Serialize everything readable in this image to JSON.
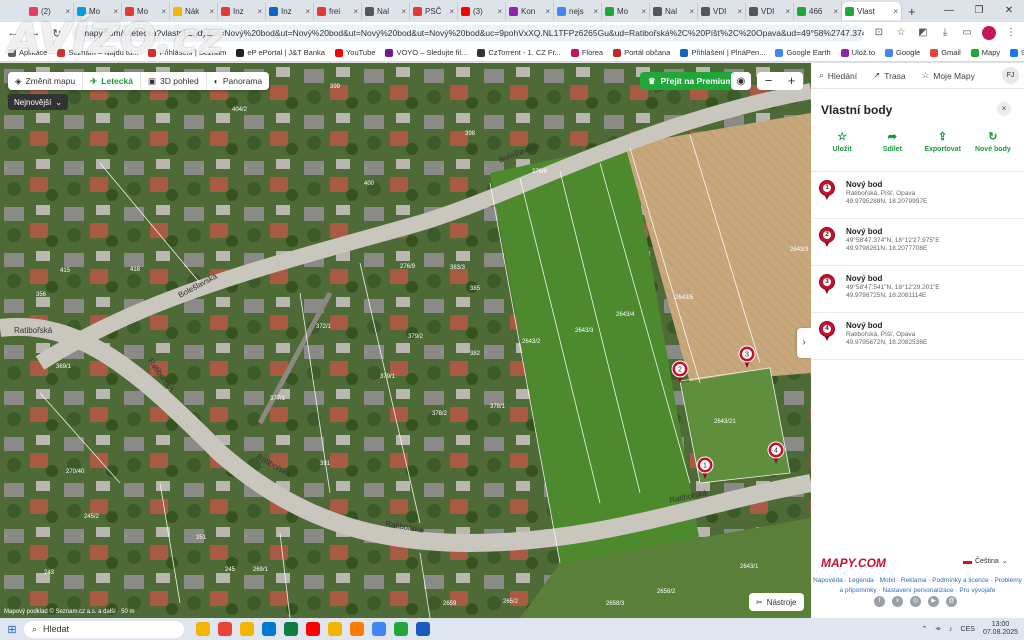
{
  "browser": {
    "tabs": [
      {
        "label": "(2)",
        "color": "#e4405f"
      },
      {
        "label": "Mo",
        "color": "#00a0e0"
      },
      {
        "label": "Mo",
        "color": "#e53935"
      },
      {
        "label": "Nák",
        "color": "#f4b400"
      },
      {
        "label": "Inz",
        "color": "#e53935"
      },
      {
        "label": "Inz",
        "color": "#0a66c2"
      },
      {
        "label": "frei",
        "color": "#e53935"
      },
      {
        "label": "Nal",
        "color": "#555"
      },
      {
        "label": "PSČ",
        "color": "#e53935"
      },
      {
        "label": "(3)",
        "color": "#ff0000"
      },
      {
        "label": "Kon",
        "color": "#8e24aa"
      },
      {
        "label": "nejs",
        "color": "#4285f4"
      },
      {
        "label": "Mo",
        "color": "#1fa839"
      },
      {
        "label": "Nal",
        "color": "#555"
      },
      {
        "label": "VDI",
        "color": "#555"
      },
      {
        "label": "VDI",
        "color": "#555"
      },
      {
        "label": "466",
        "color": "#1fa839"
      },
      {
        "label": "Vlast",
        "color": "#1fa839",
        "active": true
      }
    ],
    "url": "mapy.com/s/letecka?vlastni-body&ut=Nový%20bod&ut=Nový%20bod&ut=Nový%20bod&ut=Nový%20bod&uc=9pohVxXQ.NL1TFPz6265Gu&ud=Ratibořská%2C%20Píšť%2C%20Opava&ud=49°58%2747.374\"N%2C%2018°...",
    "bookmarks": [
      {
        "label": "Aplikace",
        "color": "#5f6368"
      },
      {
        "label": "Seznam – Najdu tu...",
        "color": "#d32f2f"
      },
      {
        "label": "Přihlášení | Seznam",
        "color": "#d32f2f"
      },
      {
        "label": "eP ePortal | J&T Banka",
        "color": "#222"
      },
      {
        "label": "YouTube",
        "color": "#ff0000"
      },
      {
        "label": "VOYO – Sledujte fil...",
        "color": "#6a1b9a"
      },
      {
        "label": "CzTorrent - 1. CZ Fr...",
        "color": "#333"
      },
      {
        "label": "Florea",
        "color": "#c2185b"
      },
      {
        "label": "Portál občana",
        "color": "#c62828"
      },
      {
        "label": "Přihlášení | PlnáPen...",
        "color": "#1565c0"
      },
      {
        "label": "Google Earth",
        "color": "#4285f4"
      },
      {
        "label": "Ulož.to",
        "color": "#8e24aa"
      },
      {
        "label": "Google",
        "color": "#4285f4"
      },
      {
        "label": "Gmail",
        "color": "#ea4335"
      },
      {
        "label": "Mapy",
        "color": "#1fa839"
      },
      {
        "label": "9",
        "color": "#1877f2"
      }
    ]
  },
  "watermark": "AVÍZO.cz",
  "map": {
    "toolbar": [
      {
        "label": "Změnit mapu",
        "icon": "layers-icon"
      },
      {
        "label": "Letecká",
        "icon": "plane-icon",
        "active": true
      },
      {
        "label": "3D pohled",
        "icon": "cube-icon"
      },
      {
        "label": "Panorama",
        "icon": "panorama-icon"
      }
    ],
    "newest_select": "Nejnovější",
    "premium_label": "Přejít na Premium",
    "zoom_out": "−",
    "zoom_in": "+",
    "tools_label": "Nástroje",
    "streets": [
      "Bolešlavská",
      "Bolešlavská",
      "Ratibořská",
      "Ratibořská",
      "Ratibořská",
      "Ratibořská",
      "Ratibořská",
      "Bolešlavská"
    ],
    "parcels": [
      "399",
      "404/2",
      "400",
      "398",
      "415",
      "418",
      "356",
      "372/1",
      "379/2",
      "382",
      "379/1",
      "377/1",
      "2643/5",
      "2643/3",
      "2643/4",
      "2643/2",
      "2643/21",
      "2643/3",
      "276/6",
      "276/9",
      "383/3",
      "385",
      "378/2",
      "378/1",
      "270/40",
      "245/2",
      "351",
      "245",
      "243",
      "2659",
      "2658/3",
      "2658/2",
      "2643/1",
      "265/2",
      "269/1",
      "369/1",
      "391"
    ],
    "markers": [
      "1",
      "2",
      "3",
      "4"
    ],
    "scale": "Mapový podklad © Seznam.cz a.s. a další · 50 m"
  },
  "sidebar": {
    "nav": [
      {
        "label": "Hledání",
        "icon": "search-icon"
      },
      {
        "label": "Trasa",
        "icon": "route-icon"
      },
      {
        "label": "Moje Mapy",
        "icon": "star-icon"
      }
    ],
    "avatar": "FJ",
    "title": "Vlastní body",
    "close": "×",
    "actions": [
      {
        "label": "Uložit",
        "icon": "star-icon"
      },
      {
        "label": "Sdílet",
        "icon": "share-icon"
      },
      {
        "label": "Exportovat",
        "icon": "export-icon"
      },
      {
        "label": "Nové body",
        "icon": "refresh-icon"
      }
    ],
    "points": [
      {
        "num": "1",
        "title": "Nový bod",
        "line1": "Ratibořská, Píšť, Opava",
        "line2": "49.9795288N, 18.2079997E"
      },
      {
        "num": "2",
        "title": "Nový bod",
        "line1": "49°58'47.374\"N, 18°12'27.975\"E",
        "line2": "49.9798261N, 18.2077708E"
      },
      {
        "num": "3",
        "title": "Nový bod",
        "line1": "49°58'47.541\"N, 18°12'29.201\"E",
        "line2": "49.9798725N, 18.2081114E"
      },
      {
        "num": "4",
        "title": "Nový bod",
        "line1": "Ratibořská, Píšť, Opava",
        "line2": "49.9795672N, 18.2082536E"
      }
    ],
    "logo": "MAPY.COM",
    "language": "Čeština",
    "links": "Nápověda · Legenda · Mobil · Reklama · Podmínky a licence · Problémy a připomínky · Nastavení personalizace · Pro vývojáře"
  },
  "taskbar": {
    "search": "Hledat",
    "apps": [
      "#f4b400",
      "#ea4335",
      "#f4b400",
      "#0078d4",
      "#107c41",
      "#ff0000",
      "#f4b400",
      "#ff7a00",
      "#4285f4",
      "#1fa839",
      "#185abd"
    ],
    "lang": "CES",
    "time": "13:00",
    "date": "07.08.2025"
  }
}
